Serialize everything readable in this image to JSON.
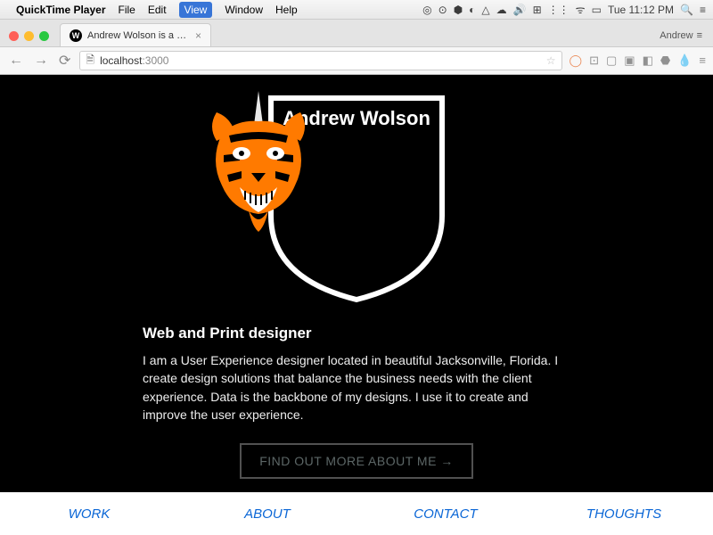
{
  "menubar": {
    "app": "QuickTime Player",
    "items": [
      "File",
      "Edit",
      "View",
      "Window",
      "Help"
    ],
    "highlighted_index": 2,
    "clock": "Tue 11:12 PM"
  },
  "browser": {
    "tab_title": "Andrew Wolson is a UX an…",
    "tab_close": "×",
    "profile_label": "Andrew",
    "url_host": "localhost",
    "url_port": ":3000"
  },
  "page": {
    "shield_name": "Andrew Wolson",
    "subheadline": "Web and Print designer",
    "body": "I am a User Experience designer located in beautiful Jacksonville, Florida. I create design solutions that balance the business needs with the client experience. Data is the backbone of my designs. I use it to create and improve the user experience.",
    "cta_label": "FIND OUT MORE ABOUT ME →"
  },
  "nav": {
    "items": [
      "WORK",
      "ABOUT",
      "CONTACT",
      "THOUGHTS"
    ]
  },
  "colors": {
    "accent": "#ff7a00",
    "link": "#0a66d6"
  }
}
